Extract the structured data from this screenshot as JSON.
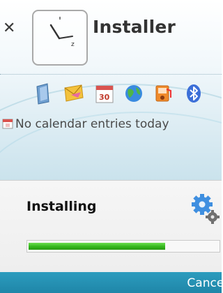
{
  "home": {
    "app_title": "Installer",
    "clock_digit": "z",
    "calendar_text": "No calendar entries today",
    "calendar_date": "30",
    "shortcuts": [
      {
        "icon": "contacts-icon"
      },
      {
        "icon": "messaging-icon"
      },
      {
        "icon": "calendar-icon"
      },
      {
        "icon": "web-browser-icon"
      },
      {
        "icon": "music-player-icon"
      },
      {
        "icon": "bluetooth-icon"
      }
    ]
  },
  "dialog": {
    "title": "Installing",
    "progress": 0.72,
    "icon": "gears-icon"
  },
  "softkeys": {
    "right_label": "Cancel"
  },
  "colors": {
    "softkey_bar": "#2190b3",
    "progress_green": "#33b61c"
  }
}
